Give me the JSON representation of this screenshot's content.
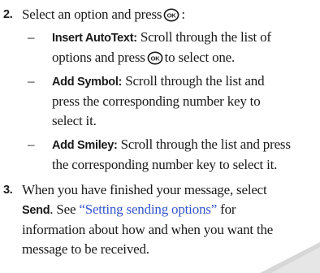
{
  "step2": {
    "number": "2.",
    "text": "Select an option and press",
    "text_end": ":",
    "icon": "ok-key-icon"
  },
  "bullets": [
    {
      "dash": "–",
      "label": "Insert AutoText:",
      "line1": "Scroll through the list of",
      "line2_a": "options and press",
      "line2_b": "to select one.",
      "icon": "ok-key-icon"
    },
    {
      "dash": "–",
      "label": "Add Symbol:",
      "line1": "Scroll through the list and",
      "line2": "press the corresponding number key to",
      "line3": "select it."
    },
    {
      "dash": "–",
      "label": "Add Smiley:",
      "line1": "Scroll through the list and press",
      "line2": "the corresponding number key to select it."
    }
  ],
  "step3": {
    "number": "3.",
    "line1": "When you have finished your message, select",
    "send_label": "Send",
    "line2_after_send": ". See",
    "link": "“Setting sending options”",
    "line2_end": "for",
    "line3": "information about how and when you want the",
    "line4": "message to be received."
  },
  "colors": {
    "text": "#1a1a1a",
    "link": "#3355cc",
    "page_curl": "#d7d7d7"
  }
}
